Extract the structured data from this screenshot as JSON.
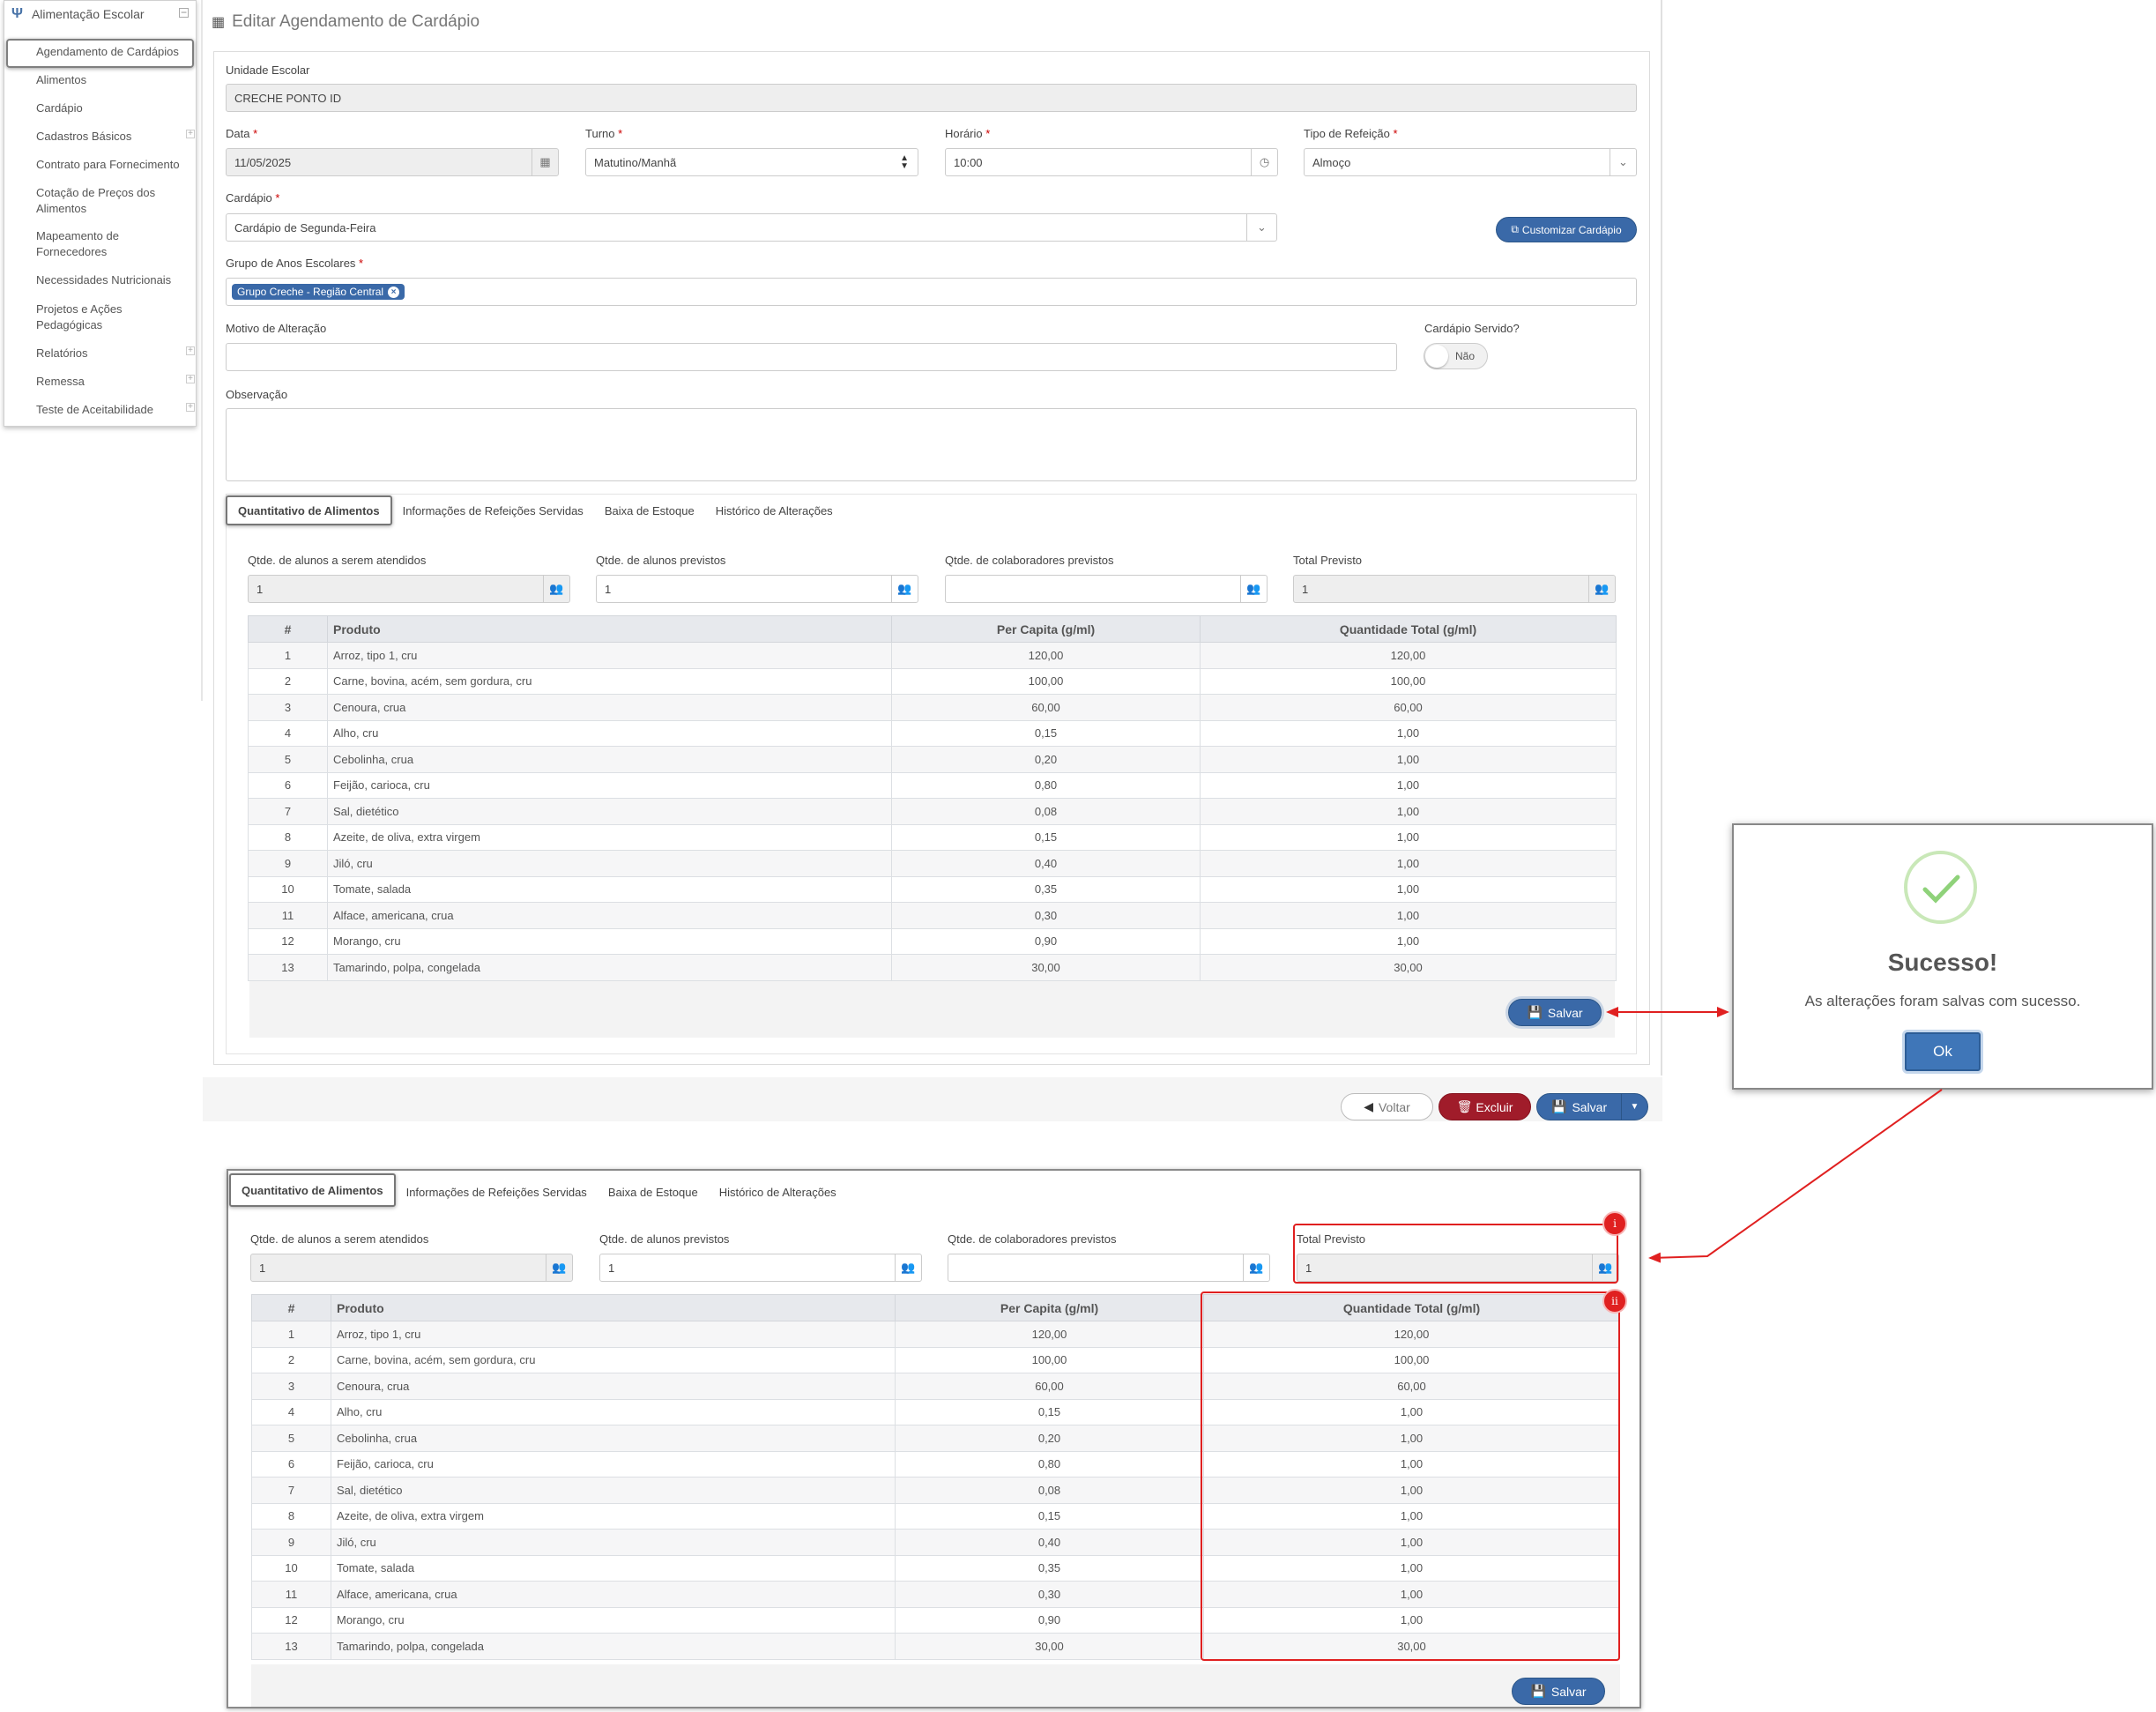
{
  "sidebar": {
    "module": "Alimentação Escolar",
    "items": [
      {
        "label": "Agendamento de Cardápios"
      },
      {
        "label": "Alimentos"
      },
      {
        "label": "Cardápio"
      },
      {
        "label": "Cadastros Básicos"
      },
      {
        "label": "Contrato para Fornecimento"
      },
      {
        "label": "Cotação de Preços dos Alimentos"
      },
      {
        "label": "Mapeamento de Fornecedores"
      },
      {
        "label": "Necessidades Nutricionais"
      },
      {
        "label": "Projetos e Ações Pedagógicas"
      },
      {
        "label": "Relatórios"
      },
      {
        "label": "Remessa"
      },
      {
        "label": "Teste de Aceitabilidade"
      }
    ]
  },
  "page": {
    "title": "Editar Agendamento de Cardápio"
  },
  "form": {
    "unidade_label": "Unidade Escolar",
    "unidade_value": "CRECHE PONTO ID",
    "data_label": "Data",
    "data_value": "11/05/2025",
    "turno_label": "Turno",
    "turno_value": "Matutino/Manhã",
    "horario_label": "Horário",
    "horario_value": "10:00",
    "tipo_label": "Tipo de Refeição",
    "tipo_value": "Almoço",
    "cardapio_label": "Cardápio",
    "cardapio_value": "Cardápio de Segunda-Feira",
    "customizar_label": "Customizar Cardápio",
    "grupo_label": "Grupo de Anos Escolares",
    "grupo_tag": "Grupo Creche - Região Central",
    "motivo_label": "Motivo de Alteração",
    "servido_label": "Cardápio Servido?",
    "servido_value": "Não",
    "obs_label": "Observação",
    "req_mark": "*"
  },
  "tabs": [
    "Quantitativo de Alimentos",
    "Informações de Refeições Servidas",
    "Baixa de Estoque",
    "Histórico de Alterações"
  ],
  "quant": {
    "alunos_atendidos_label": "Qtde. de alunos a serem atendidos",
    "alunos_atendidos_value": "1",
    "alunos_previstos_label": "Qtde. de alunos previstos",
    "alunos_previstos_value": "1",
    "colab_label": "Qtde. de colaboradores previstos",
    "colab_value": "",
    "total_label": "Total Previsto",
    "total_value": "1"
  },
  "table": {
    "headers": [
      "#",
      "Produto",
      "Per Capita (g/ml)",
      "Quantidade Total (g/ml)"
    ],
    "rows": [
      [
        "1",
        "Arroz, tipo 1, cru",
        "120,00",
        "120,00"
      ],
      [
        "2",
        "Carne, bovina, acém, sem gordura, cru",
        "100,00",
        "100,00"
      ],
      [
        "3",
        "Cenoura, crua",
        "60,00",
        "60,00"
      ],
      [
        "4",
        "Alho, cru",
        "0,15",
        "1,00"
      ],
      [
        "5",
        "Cebolinha, crua",
        "0,20",
        "1,00"
      ],
      [
        "6",
        "Feijão, carioca, cru",
        "0,80",
        "1,00"
      ],
      [
        "7",
        "Sal, dietético",
        "0,08",
        "1,00"
      ],
      [
        "8",
        "Azeite, de oliva, extra virgem",
        "0,15",
        "1,00"
      ],
      [
        "9",
        "Jiló, cru",
        "0,40",
        "1,00"
      ],
      [
        "10",
        "Tomate, salada",
        "0,35",
        "1,00"
      ],
      [
        "11",
        "Alface, americana, crua",
        "0,30",
        "1,00"
      ],
      [
        "12",
        "Morango, cru",
        "0,90",
        "1,00"
      ],
      [
        "13",
        "Tamarindo, polpa, congelada",
        "30,00",
        "30,00"
      ]
    ]
  },
  "buttons": {
    "salvar": "Salvar",
    "voltar": "Voltar",
    "excluir": "Excluir"
  },
  "dialog": {
    "title": "Sucesso!",
    "message": "As alterações foram salvas com sucesso.",
    "ok": "Ok"
  },
  "annotations": {
    "badge_i": "i",
    "badge_ii": "ii"
  },
  "colors": {
    "primary": "#3a69a8",
    "danger": "#a01c2a",
    "annotation": "#e02020",
    "success": "#8fd27a"
  }
}
